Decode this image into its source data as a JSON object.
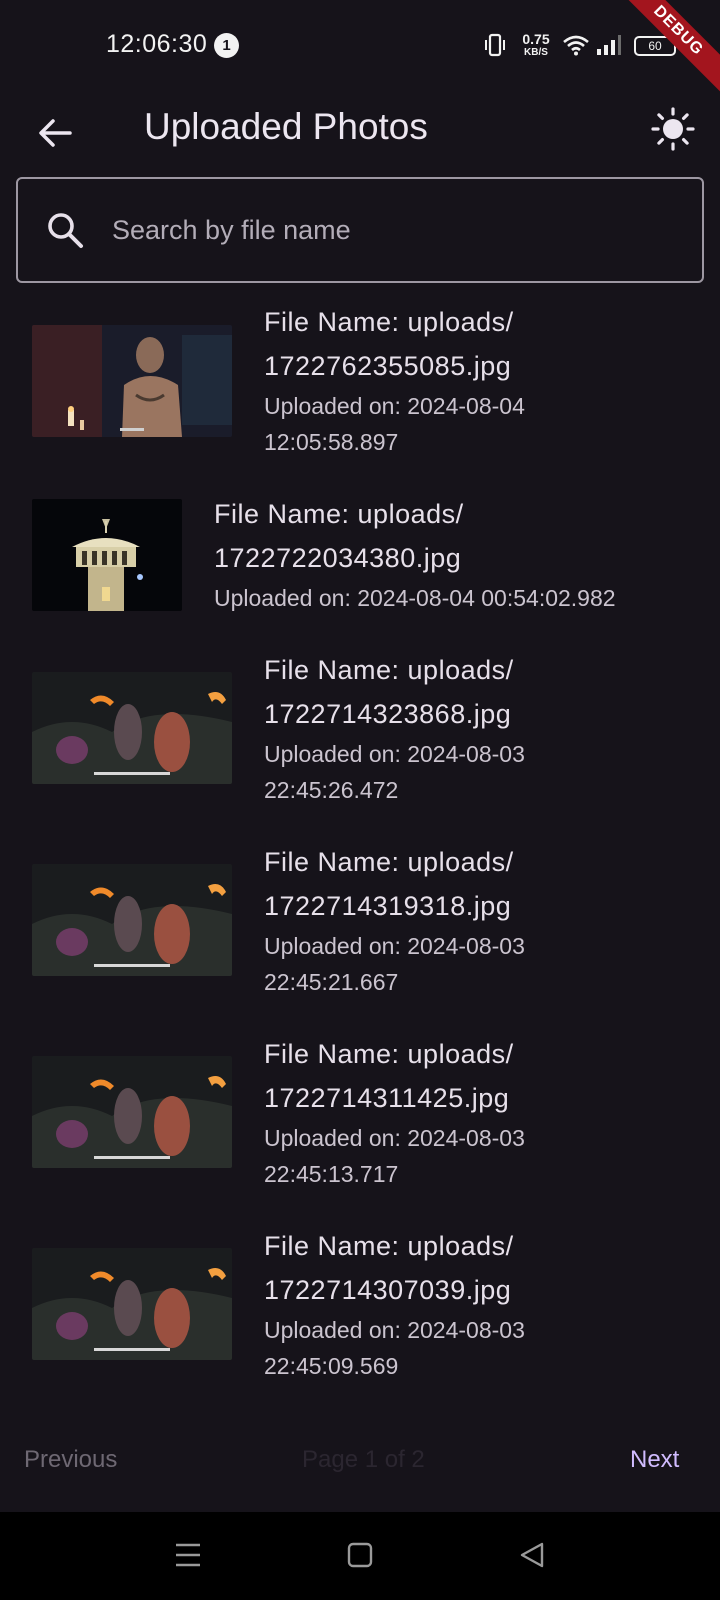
{
  "status_bar": {
    "time": "12:06:30",
    "notification_count": "1",
    "net_speed_value": "0.75",
    "net_speed_unit": "KB/S",
    "battery": "60"
  },
  "debug_banner": "DEBUG",
  "app_bar": {
    "title": "Uploaded Photos",
    "back_icon": "arrow-left-icon",
    "theme_icon": "sun-icon"
  },
  "search": {
    "placeholder": "Search by file name",
    "value": ""
  },
  "photos": [
    {
      "file_line1": "File Name: uploads/",
      "file_line2": "1722762355085.jpg",
      "date_line1": "Uploaded on: 2024-08-04",
      "date_line2": "12:05:58.897"
    },
    {
      "file_line1": "File Name: uploads/",
      "file_line2": "1722722034380.jpg",
      "date_line1": "Uploaded on: 2024-08-04 00:54:02.982",
      "date_line2": ""
    },
    {
      "file_line1": "File Name: uploads/",
      "file_line2": "1722714323868.jpg",
      "date_line1": "Uploaded on: 2024-08-03",
      "date_line2": "22:45:26.472"
    },
    {
      "file_line1": "File Name: uploads/",
      "file_line2": "1722714319318.jpg",
      "date_line1": "Uploaded on: 2024-08-03",
      "date_line2": "22:45:21.667"
    },
    {
      "file_line1": "File Name: uploads/",
      "file_line2": "1722714311425.jpg",
      "date_line1": "Uploaded on: 2024-08-03",
      "date_line2": "22:45:13.717"
    },
    {
      "file_line1": "File Name: uploads/",
      "file_line2": "1722714307039.jpg",
      "date_line1": "Uploaded on: 2024-08-03",
      "date_line2": "22:45:09.569"
    }
  ],
  "pagination": {
    "previous_label": "Previous",
    "page_label": "Page 1 of 2",
    "next_label": "Next"
  },
  "colors": {
    "background": "#16131a",
    "accent": "#d1bcff",
    "debug": "#a3151e"
  }
}
